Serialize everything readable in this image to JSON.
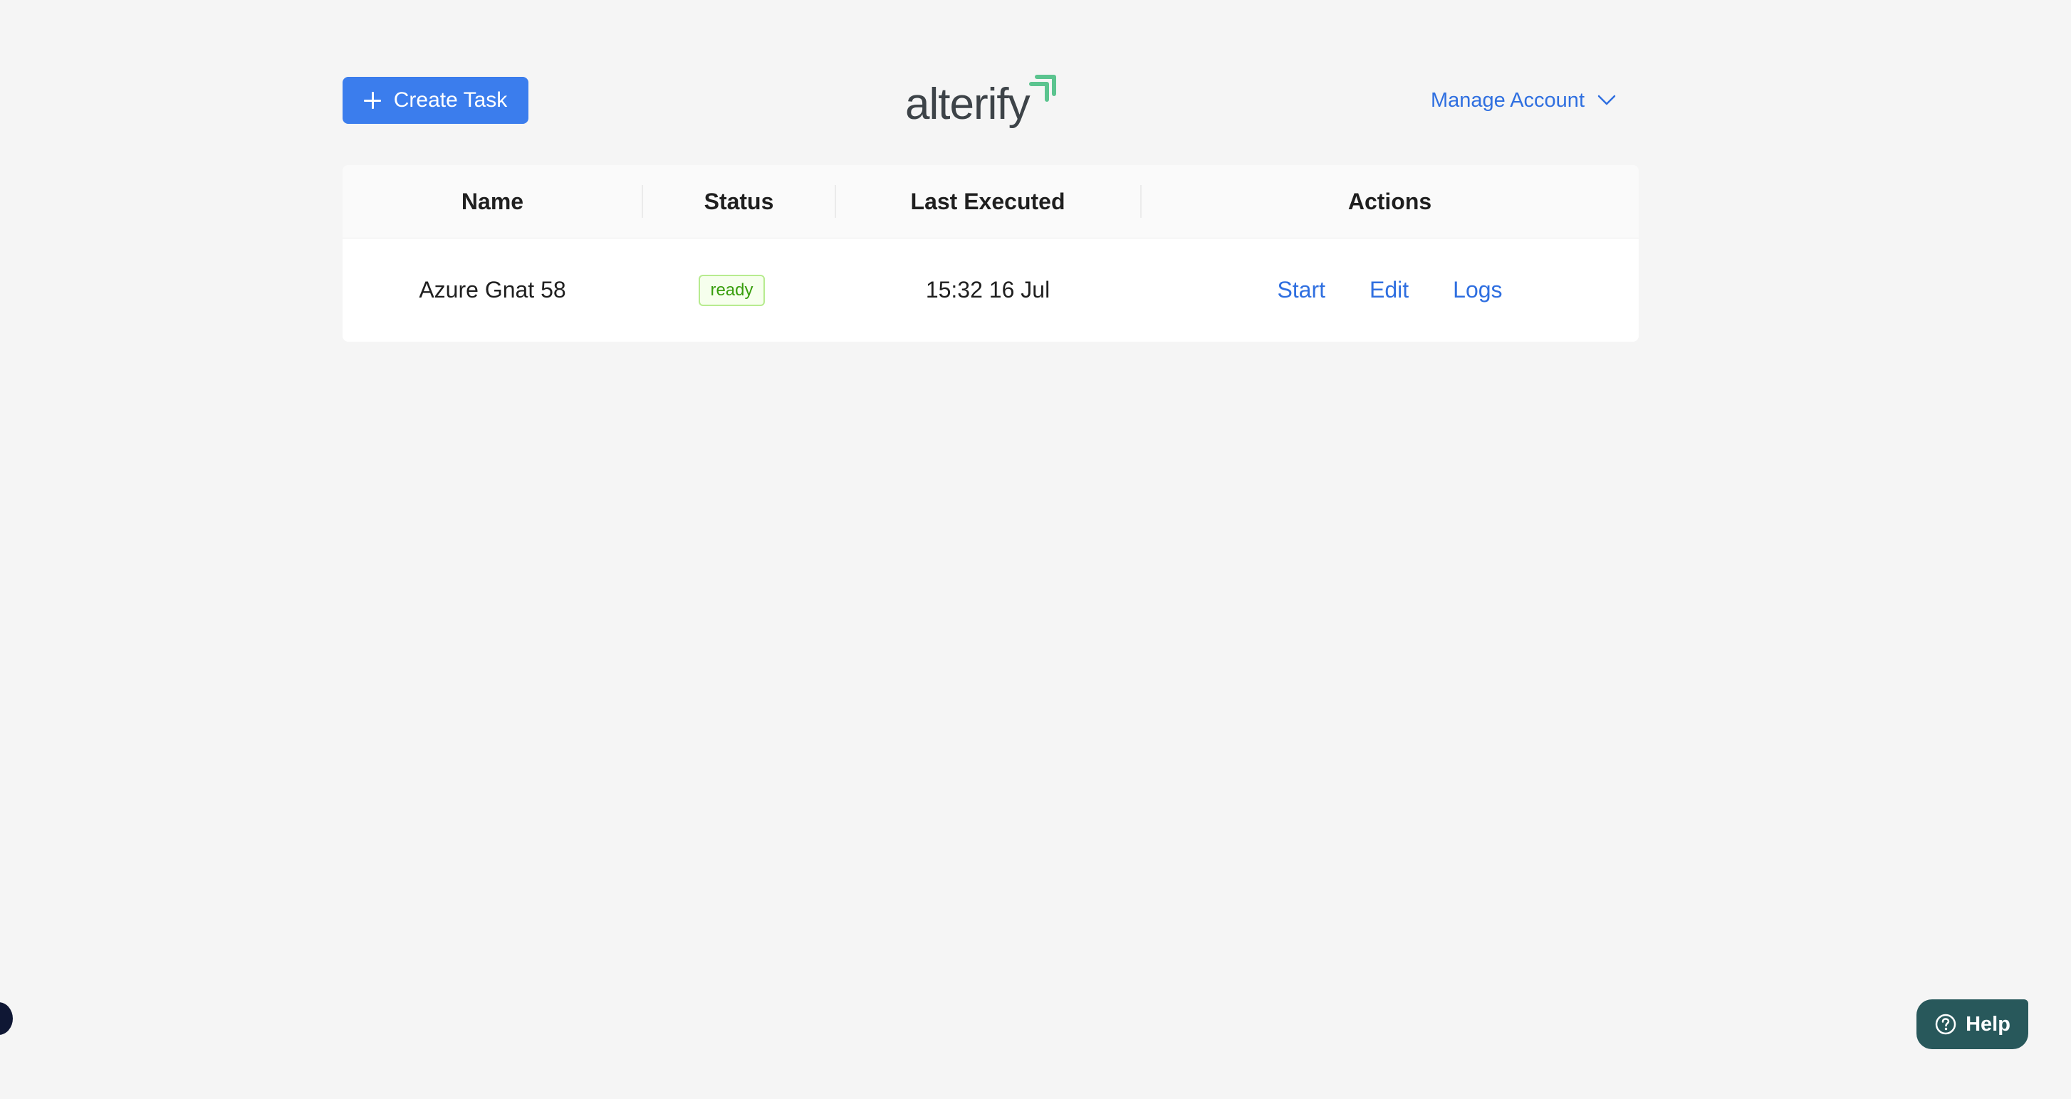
{
  "header": {
    "create_label": "Create Task",
    "logo_text": "alterify",
    "manage_label": "Manage Account"
  },
  "table": {
    "columns": [
      "Name",
      "Status",
      "Last Executed",
      "Actions"
    ],
    "rows": [
      {
        "name": "Azure Gnat 58",
        "status": "ready",
        "last_executed": "15:32 16 Jul",
        "actions": [
          "Start",
          "Edit",
          "Logs"
        ]
      }
    ]
  },
  "help": {
    "label": "Help"
  },
  "colors": {
    "primary": "#3b7ded",
    "link": "#2f6fe0",
    "logo_accent": "#5bc48f",
    "help_bg": "#28585b",
    "ready_green": "#389e0d"
  },
  "icons": {
    "create": "plus-icon",
    "manage": "chevron-down-icon",
    "help": "question-circle-icon",
    "logo": "arrow-up-right-icon"
  }
}
